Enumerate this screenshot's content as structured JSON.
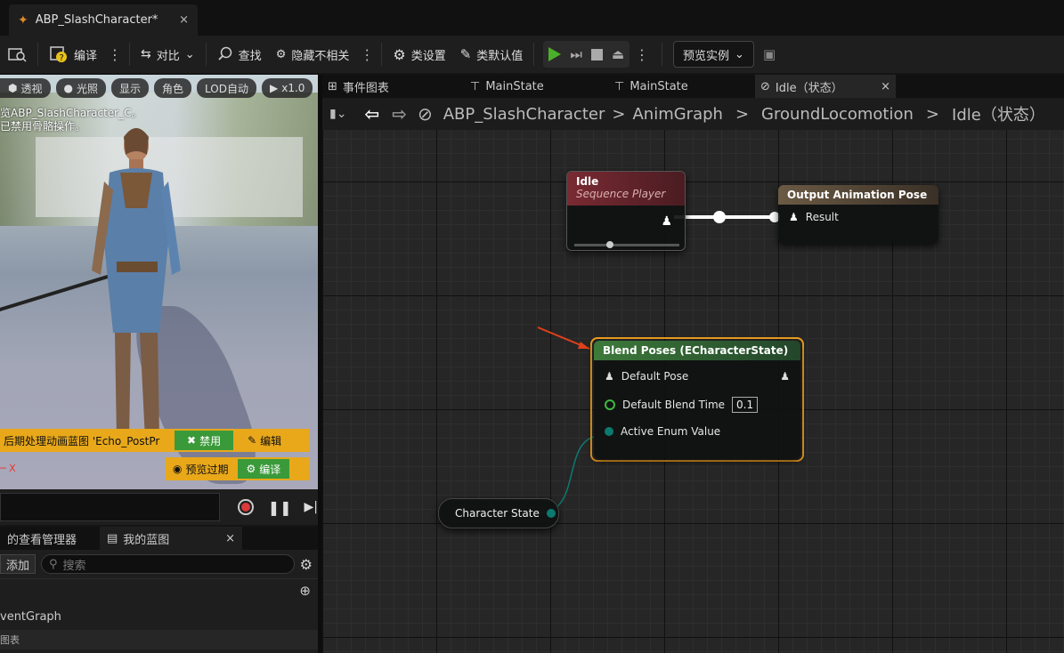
{
  "window": {
    "doc_tab": "ABP_SlashCharacter*",
    "close_glyph": "×"
  },
  "toolbar": {
    "compile": "编译",
    "diff": "对比",
    "find": "查找",
    "hide_unrelated": "隐藏不相关",
    "class_settings": "类设置",
    "class_defaults": "类默认值",
    "preview_instance": "预览实例"
  },
  "viewport": {
    "buttons": {
      "perspective": "透视",
      "lighting": "光照",
      "show": "显示",
      "character": "角色",
      "lod": "LOD自动",
      "speed": "x1.0"
    },
    "message_line1": "览ABP_SlashCharacter_C。",
    "message_line2": "已禁用骨骼操作。",
    "post_process_text": "后期处理动画蓝图 'Echo_PostPr",
    "disable_btn": "禁用",
    "edit_btn": "编辑",
    "preview_expired": "预览过期",
    "compile_btn": "编译",
    "axis_label": "X"
  },
  "bottom": {
    "tab_view_manager": "的查看管理器",
    "tab_my_blueprint": "我的蓝图",
    "add_label": "添加",
    "search_placeholder": "搜索",
    "event_graph": "ventGraph",
    "graphs_label": "图表"
  },
  "graph_tabs": {
    "event_graph": "事件图表",
    "main_state_1": "MainState",
    "main_state_2": "MainState",
    "idle_state": "Idle（状态）"
  },
  "breadcrumb": {
    "items": [
      "ABP_SlashCharacter",
      "AnimGraph",
      "GroundLocomotion",
      "Idle（状态）"
    ],
    "separator": ">"
  },
  "nodes": {
    "idle": {
      "title": "Idle",
      "subtitle": "Sequence Player"
    },
    "output_pose": {
      "title": "Output Animation Pose",
      "pin_result": "Result"
    },
    "blend_poses": {
      "title": "Blend Poses (ECharacterState)",
      "pin_default_pose": "Default Pose",
      "pin_blend_time": "Default Blend Time",
      "blend_time_value": "0.1",
      "pin_active_enum": "Active Enum Value"
    },
    "character_state": {
      "title": "Character State"
    }
  },
  "colors": {
    "accent_orange": "#f0a020",
    "play_green": "#4caf2a",
    "enum_teal": "#0b7a6f",
    "sequence_header": "#7a2a32",
    "blend_header": "#3c7a3a",
    "warning_yellow": "#e8a81a"
  }
}
